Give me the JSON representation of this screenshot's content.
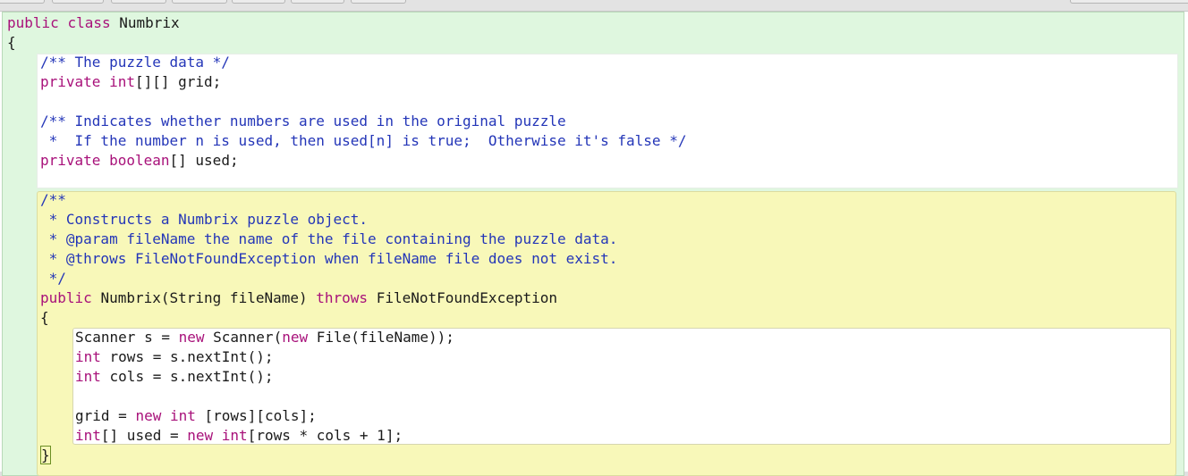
{
  "code": {
    "l1_kw1": "public",
    "l1_kw2": "class",
    "l1_name": "Numbrix",
    "l2": "{",
    "l3": "/** The puzzle data */",
    "l4_kw1": "private",
    "l4_kw2": "int",
    "l4_rest": "[][] grid;",
    "l6": "/** Indicates whether numbers are used in the original puzzle",
    "l7": " *  If the number n is used, then used[n] is true;  Otherwise it's false */",
    "l8_kw1": "private",
    "l8_kw2": "boolean",
    "l8_rest": "[] used;",
    "l10": "/**",
    "l11": " * Constructs a Numbrix puzzle object.",
    "l12": " * @param fileName the name of the file containing the puzzle data.",
    "l13": " * @throws FileNotFoundException when fileName file does not exist.",
    "l14": " */",
    "l15_kw1": "public",
    "l15_mid": "Numbrix(String fileName)",
    "l15_kw2": "throws",
    "l15_rest": "FileNotFoundException",
    "l16": "{",
    "l17_a": "Scanner s = ",
    "l17_kw1": "new",
    "l17_b": " Scanner(",
    "l17_kw2": "new",
    "l17_c": " File(fileName));",
    "l18_kw": "int",
    "l18_rest": " rows = s.nextInt();",
    "l19_kw": "int",
    "l19_rest": " cols = s.nextInt();",
    "l21_a": "grid = ",
    "l21_kw1": "new",
    "l21_kw2": "int",
    "l21_rest": " [rows][cols];",
    "l22_kw1": "int",
    "l22_a": "[] used = ",
    "l22_kw2": "new",
    "l22_kw3": "int",
    "l22_rest": "[rows * cols + 1];",
    "l23": "}"
  }
}
